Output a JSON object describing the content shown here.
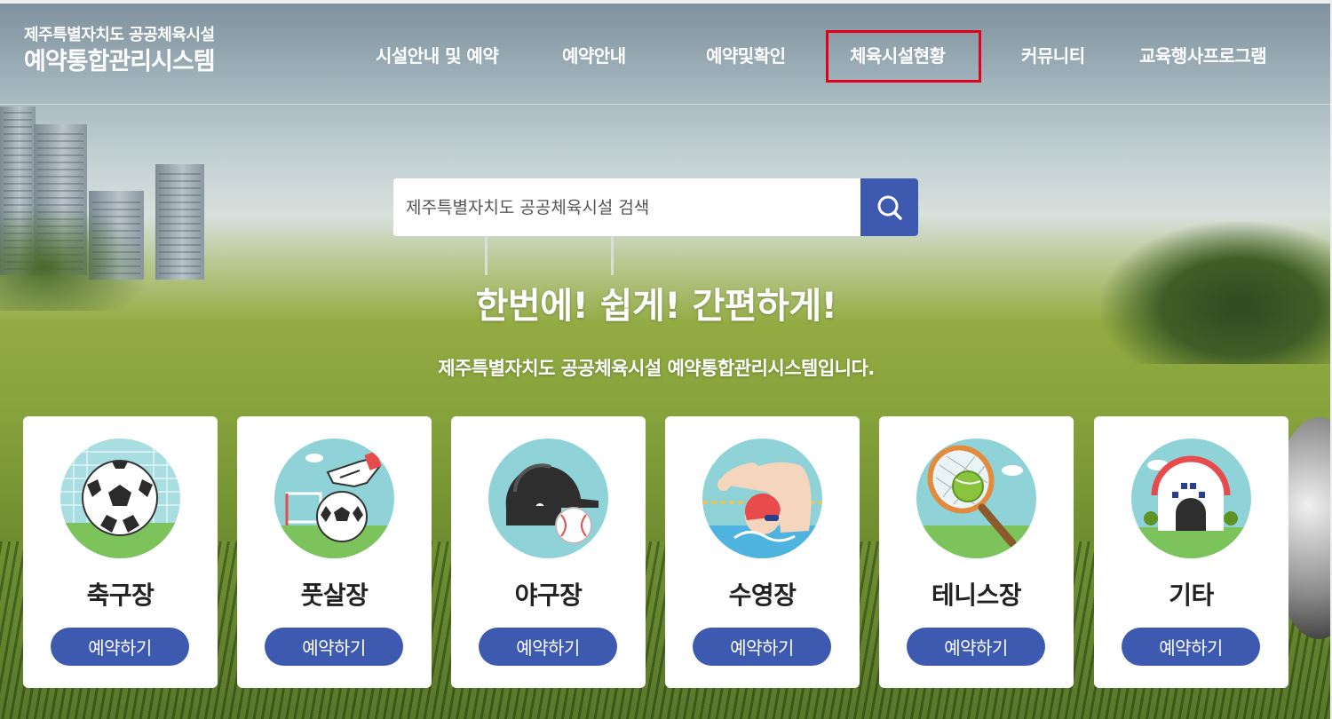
{
  "header": {
    "logo_small": "제주특별자치도 공공체육시설",
    "logo_big": "예약통합관리시스템",
    "nav": [
      {
        "label": "시설안내 및 예약"
      },
      {
        "label": "예약안내"
      },
      {
        "label": "예약및확인"
      },
      {
        "label": "체육시설현황"
      },
      {
        "label": "커뮤니티"
      },
      {
        "label": "교육행사프로그램"
      }
    ],
    "highlighted_nav": "체육시설현황",
    "highlight_color": "#e3001b"
  },
  "search": {
    "placeholder": "제주특별자치도 공공체육시설 검색",
    "button_icon": "search-icon",
    "button_color": "#3d5ab0"
  },
  "hero": {
    "headline": "한번에! 쉽게! 간편하게!",
    "subline": "제주특별자치도 공공체육시설 예약통합관리시스템입니다."
  },
  "cards": [
    {
      "title": "축구장",
      "button": "예약하기",
      "icon": "soccer-ball-icon"
    },
    {
      "title": "풋살장",
      "button": "예약하기",
      "icon": "futsal-icon"
    },
    {
      "title": "야구장",
      "button": "예약하기",
      "icon": "baseball-icon"
    },
    {
      "title": "수영장",
      "button": "예약하기",
      "icon": "swimmer-icon"
    },
    {
      "title": "테니스장",
      "button": "예약하기",
      "icon": "tennis-icon"
    },
    {
      "title": "기타",
      "button": "예약하기",
      "icon": "building-icon"
    }
  ],
  "colors": {
    "accent": "#3d5ab0",
    "card_bg": "#ffffff",
    "icon_bg": "#8fd3d8"
  }
}
